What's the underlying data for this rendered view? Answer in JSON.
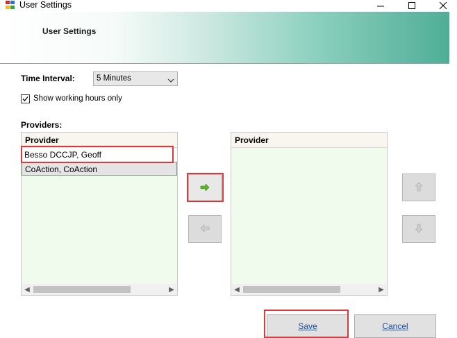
{
  "window": {
    "title": "User Settings",
    "icon": "app-window-icon",
    "minimize_icon": "minimize-icon",
    "maximize_icon": "maximize-icon",
    "close_icon": "close-icon"
  },
  "banner": {
    "title": "User Settings"
  },
  "time_interval": {
    "label": "Time Interval:",
    "selected": "5 Minutes"
  },
  "working_hours": {
    "label": "Show working hours only",
    "checked": true
  },
  "providers_label": "Providers:",
  "left_list": {
    "header": "Provider",
    "items": [
      "Besso DCCJP, Geoff",
      "CoAction, CoAction"
    ]
  },
  "right_list": {
    "header": "Provider",
    "items": []
  },
  "buttons": {
    "move_right_icon": "arrow-right-icon",
    "move_left_icon": "arrow-left-icon",
    "move_up_icon": "arrow-up-icon",
    "move_down_icon": "arrow-down-icon",
    "save": "Save",
    "cancel": "Cancel"
  },
  "colors": {
    "banner_end": "#4fae96",
    "highlight": "#d93a3a",
    "list_background": "#f1fbed"
  }
}
